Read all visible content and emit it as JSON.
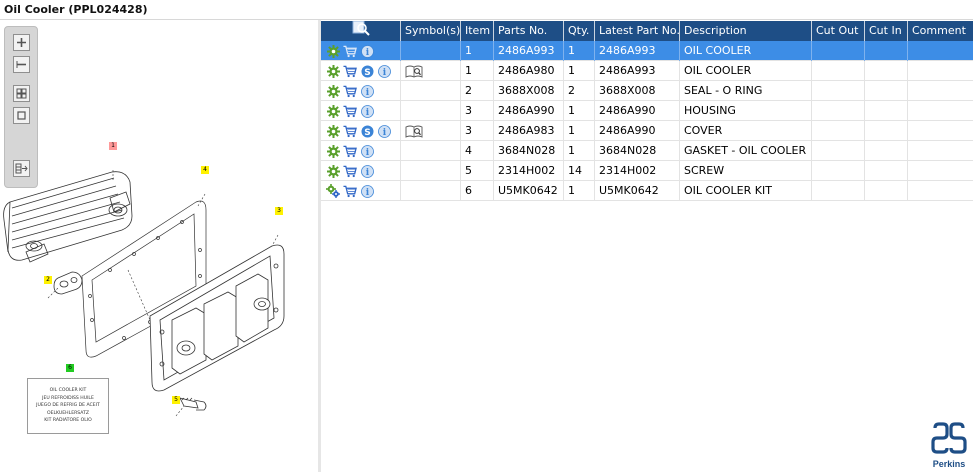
{
  "window": {
    "title": "Oil Cooler (PPL024428)"
  },
  "toolbar": {
    "zoom_in_icon": "zoom-in-icon",
    "zoom_out_icon": "zoom-out-icon",
    "fit_icon": "fit-all-icon",
    "actual_size_icon": "actual-size-icon",
    "export_icon": "export-icon"
  },
  "diagram": {
    "callouts": [
      "1",
      "4",
      "3",
      "2",
      "6",
      "5"
    ],
    "kit_label": [
      "OIL COOLER KIT",
      "JEU REFROIDISS HUILE",
      "JUEGO DE REFRIG DE ACEIT",
      "OELKUEHLERSATZ",
      "KIT RADIATORE OLIO"
    ]
  },
  "grid": {
    "headers": {
      "tools": "",
      "symbols": "Symbol(s)",
      "item": "Item",
      "parts_no": "Parts No.",
      "qty": "Qty.",
      "latest": "Latest Part No.",
      "description": "Description",
      "cut_out": "Cut Out",
      "cut_in": "Cut In",
      "comment": "Comment"
    },
    "rows": [
      {
        "item": "1",
        "parts_no": "2486A993",
        "qty": "1",
        "latest": "2486A993",
        "description": "OIL COOLER",
        "cut_out": "",
        "cut_in": "",
        "comment": ""
      },
      {
        "item": "1",
        "parts_no": "2486A980",
        "qty": "1",
        "latest": "2486A993",
        "description": "OIL COOLER",
        "cut_out": "",
        "cut_in": "",
        "comment": ""
      },
      {
        "item": "2",
        "parts_no": "3688X008",
        "qty": "2",
        "latest": "3688X008",
        "description": "SEAL - O RING",
        "cut_out": "",
        "cut_in": "",
        "comment": ""
      },
      {
        "item": "3",
        "parts_no": "2486A990",
        "qty": "1",
        "latest": "2486A990",
        "description": "HOUSING",
        "cut_out": "",
        "cut_in": "",
        "comment": ""
      },
      {
        "item": "3",
        "parts_no": "2486A983",
        "qty": "1",
        "latest": "2486A990",
        "description": "COVER",
        "cut_out": "",
        "cut_in": "",
        "comment": ""
      },
      {
        "item": "4",
        "parts_no": "3684N028",
        "qty": "1",
        "latest": "3684N028",
        "description": "GASKET - OIL COOLER",
        "cut_out": "",
        "cut_in": "",
        "comment": ""
      },
      {
        "item": "5",
        "parts_no": "2314H002",
        "qty": "14",
        "latest": "2314H002",
        "description": "SCREW",
        "cut_out": "",
        "cut_in": "",
        "comment": ""
      },
      {
        "item": "6",
        "parts_no": "U5MK0642",
        "qty": "1",
        "latest": "U5MK0642",
        "description": "OIL COOLER KIT",
        "cut_out": "",
        "cut_in": "",
        "comment": ""
      }
    ]
  },
  "brand": {
    "name": "Perkins",
    "color": "#1e4e86"
  },
  "colors": {
    "header": "#1e4e86",
    "selected": "#3d8de6",
    "gear": "#5aa02c",
    "cart": "#2f66c6",
    "info": "#3b84d6"
  }
}
